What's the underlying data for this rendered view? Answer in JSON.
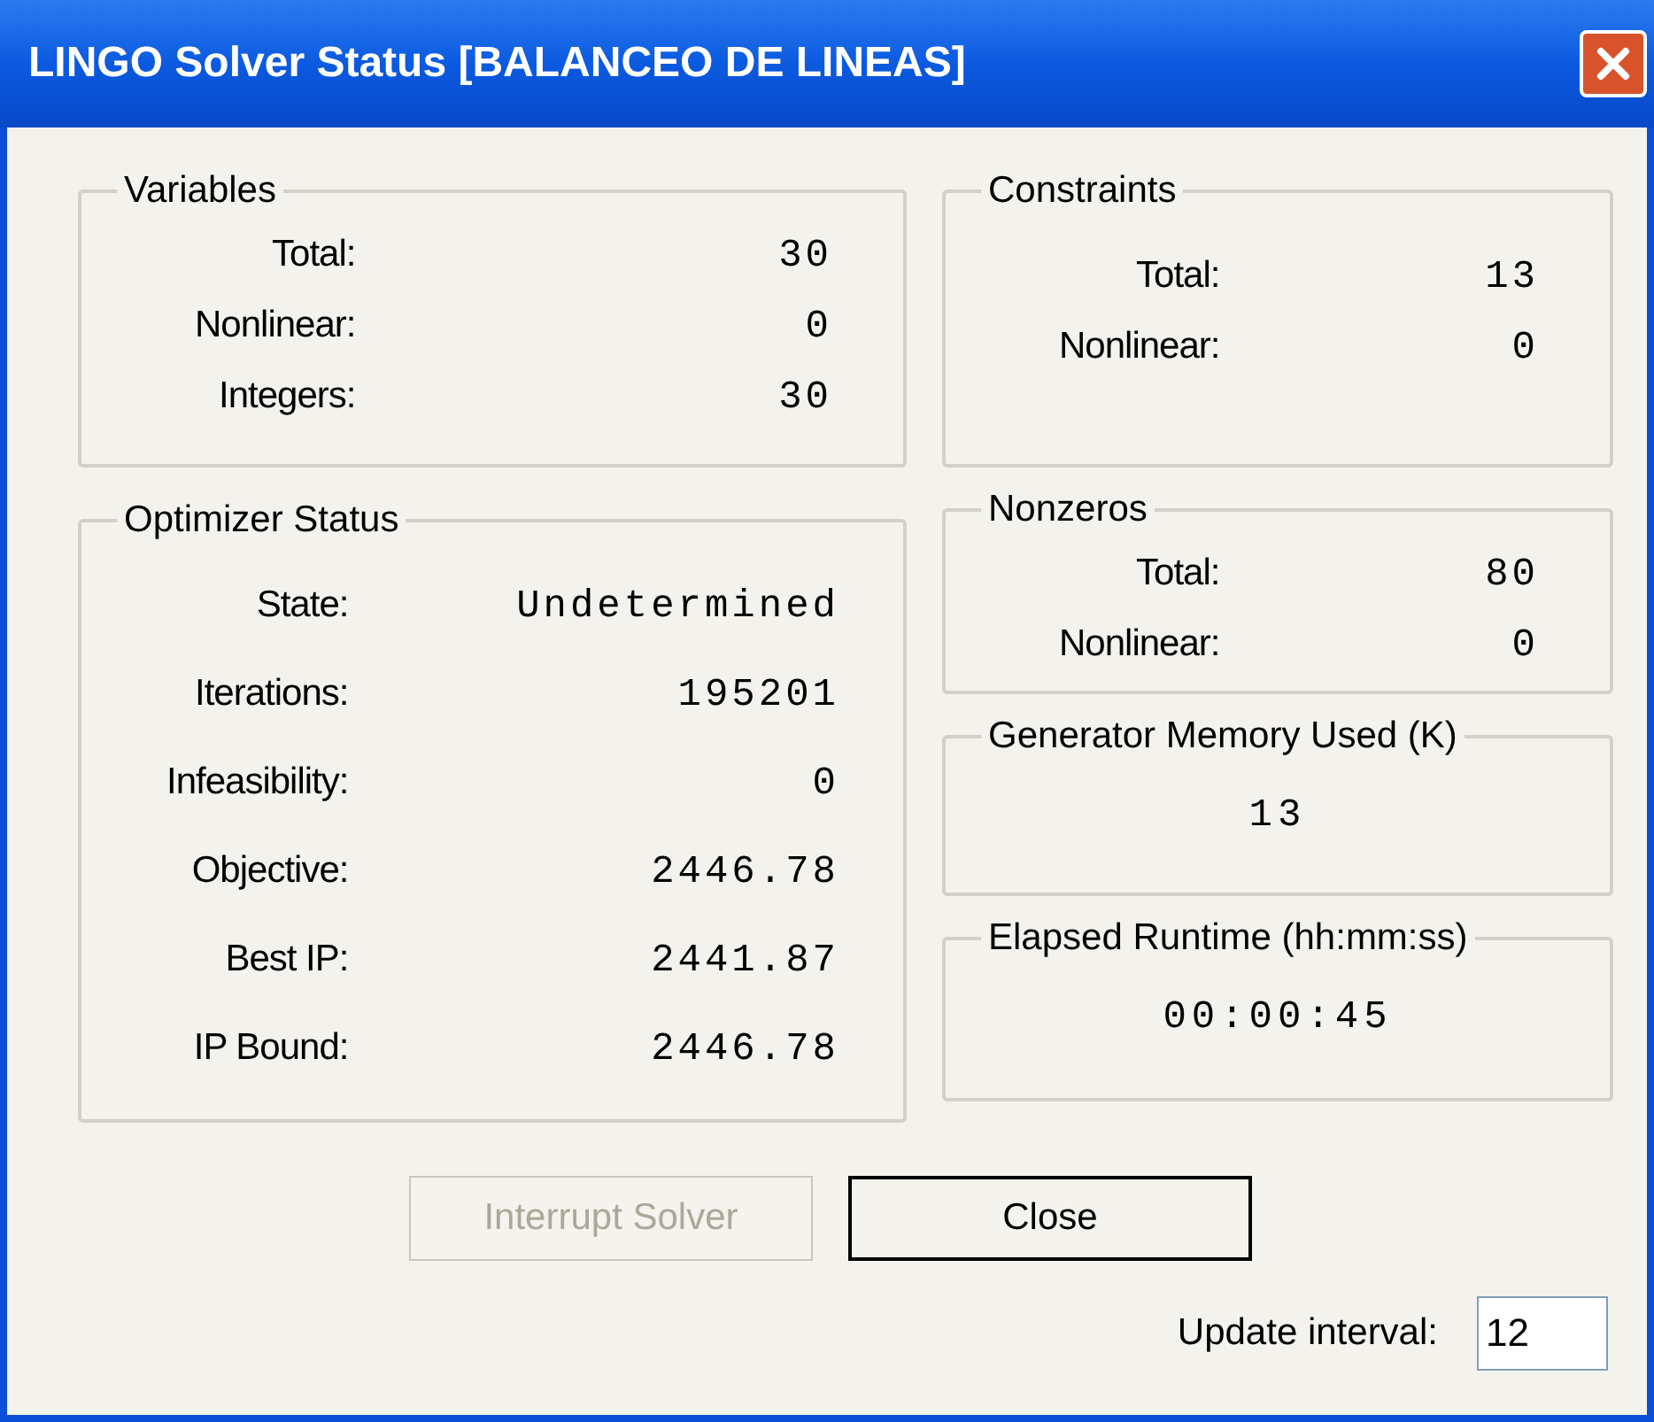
{
  "window": {
    "title": "LINGO Solver Status [BALANCEO DE LINEAS]"
  },
  "left_groups": [
    {
      "title": "Variables",
      "kind": "rows",
      "rows": [
        {
          "label": "Total:",
          "value": "30"
        },
        {
          "label": "Nonlinear:",
          "value": "0"
        },
        {
          "label": "Integers:",
          "value": "30"
        }
      ]
    },
    {
      "title": "Optimizer Status",
      "kind": "rows",
      "rows": [
        {
          "label": "State:",
          "value": "Undetermined"
        },
        {
          "label": "Iterations:",
          "value": "195201"
        },
        {
          "label": "Infeasibility:",
          "value": "0"
        },
        {
          "label": "Objective:",
          "value": "2446.78"
        },
        {
          "label": "Best IP:",
          "value": "2441.87"
        },
        {
          "label": "IP Bound:",
          "value": "2446.78"
        }
      ]
    }
  ],
  "right_groups": [
    {
      "title": "Constraints",
      "kind": "rows",
      "rows": [
        {
          "label": "Total:",
          "value": "13"
        },
        {
          "label": "Nonlinear:",
          "value": "0"
        }
      ]
    },
    {
      "title": "Nonzeros",
      "kind": "rows",
      "rows": [
        {
          "label": "Total:",
          "value": "80"
        },
        {
          "label": "Nonlinear:",
          "value": "0"
        }
      ]
    },
    {
      "title": "Generator Memory Used (K)",
      "kind": "single",
      "value": "13"
    },
    {
      "title": "Elapsed Runtime (hh:mm:ss)",
      "kind": "single",
      "value": "00:00:45"
    }
  ],
  "buttons": [
    {
      "label": "Interrupt Solver",
      "disabled": true,
      "default": false
    },
    {
      "label": "Close",
      "disabled": false,
      "default": true
    }
  ],
  "update_interval": {
    "label": "Update interval:",
    "value": "12"
  }
}
